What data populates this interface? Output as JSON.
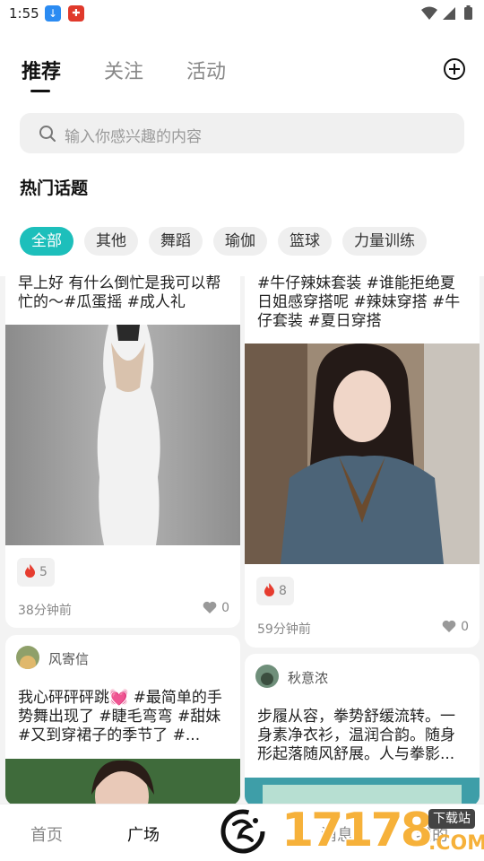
{
  "status": {
    "time": "1:55"
  },
  "tabs": [
    {
      "label": "推荐",
      "active": true
    },
    {
      "label": "关注",
      "active": false
    },
    {
      "label": "活动",
      "active": false
    }
  ],
  "search": {
    "placeholder": "输入你感兴趣的内容"
  },
  "hot_topics": {
    "title": "热门话题",
    "chips": [
      "全部",
      "其他",
      "舞蹈",
      "瑜伽",
      "篮球",
      "力量训练"
    ],
    "active_index": 0,
    "accent_color": "#1dbfbb"
  },
  "feed": {
    "left": [
      {
        "text": "早上好 有什么倒忙是我可以帮忙的～#瓜蛋摇 #成人礼",
        "image": "woman-white-dress-photo",
        "fire_count": "5",
        "time": "38分钟前",
        "likes": "0"
      },
      {
        "author": "风寄信",
        "text": "我心砰砰砰跳💓 #最简单的手势舞出现了 #睫毛弯弯 #甜妹 #又到穿裙子的季节了 #...",
        "image": "woman-portrait-photo"
      }
    ],
    "right": [
      {
        "text": "#牛仔辣妹套装 #谁能拒绝夏日姐感穿搭呢 #辣妹穿搭 #牛仔套装 #夏日穿搭",
        "image": "woman-denim-outfit-photo",
        "fire_count": "8",
        "time": "59分钟前",
        "likes": "0"
      },
      {
        "author": "秋意浓",
        "text": "步履从容，拳势舒缓流转。一身素净衣衫，温润合韵。随身形起落随风舒展。人与拳影...",
        "image": "taiji-banner-photo"
      }
    ]
  },
  "bottom_nav": {
    "items": [
      "首页",
      "广场",
      "消息",
      "我的"
    ],
    "active_index": 1
  },
  "watermark": {
    "number": "17178",
    "download": "下载站",
    "domain": ".COM"
  }
}
